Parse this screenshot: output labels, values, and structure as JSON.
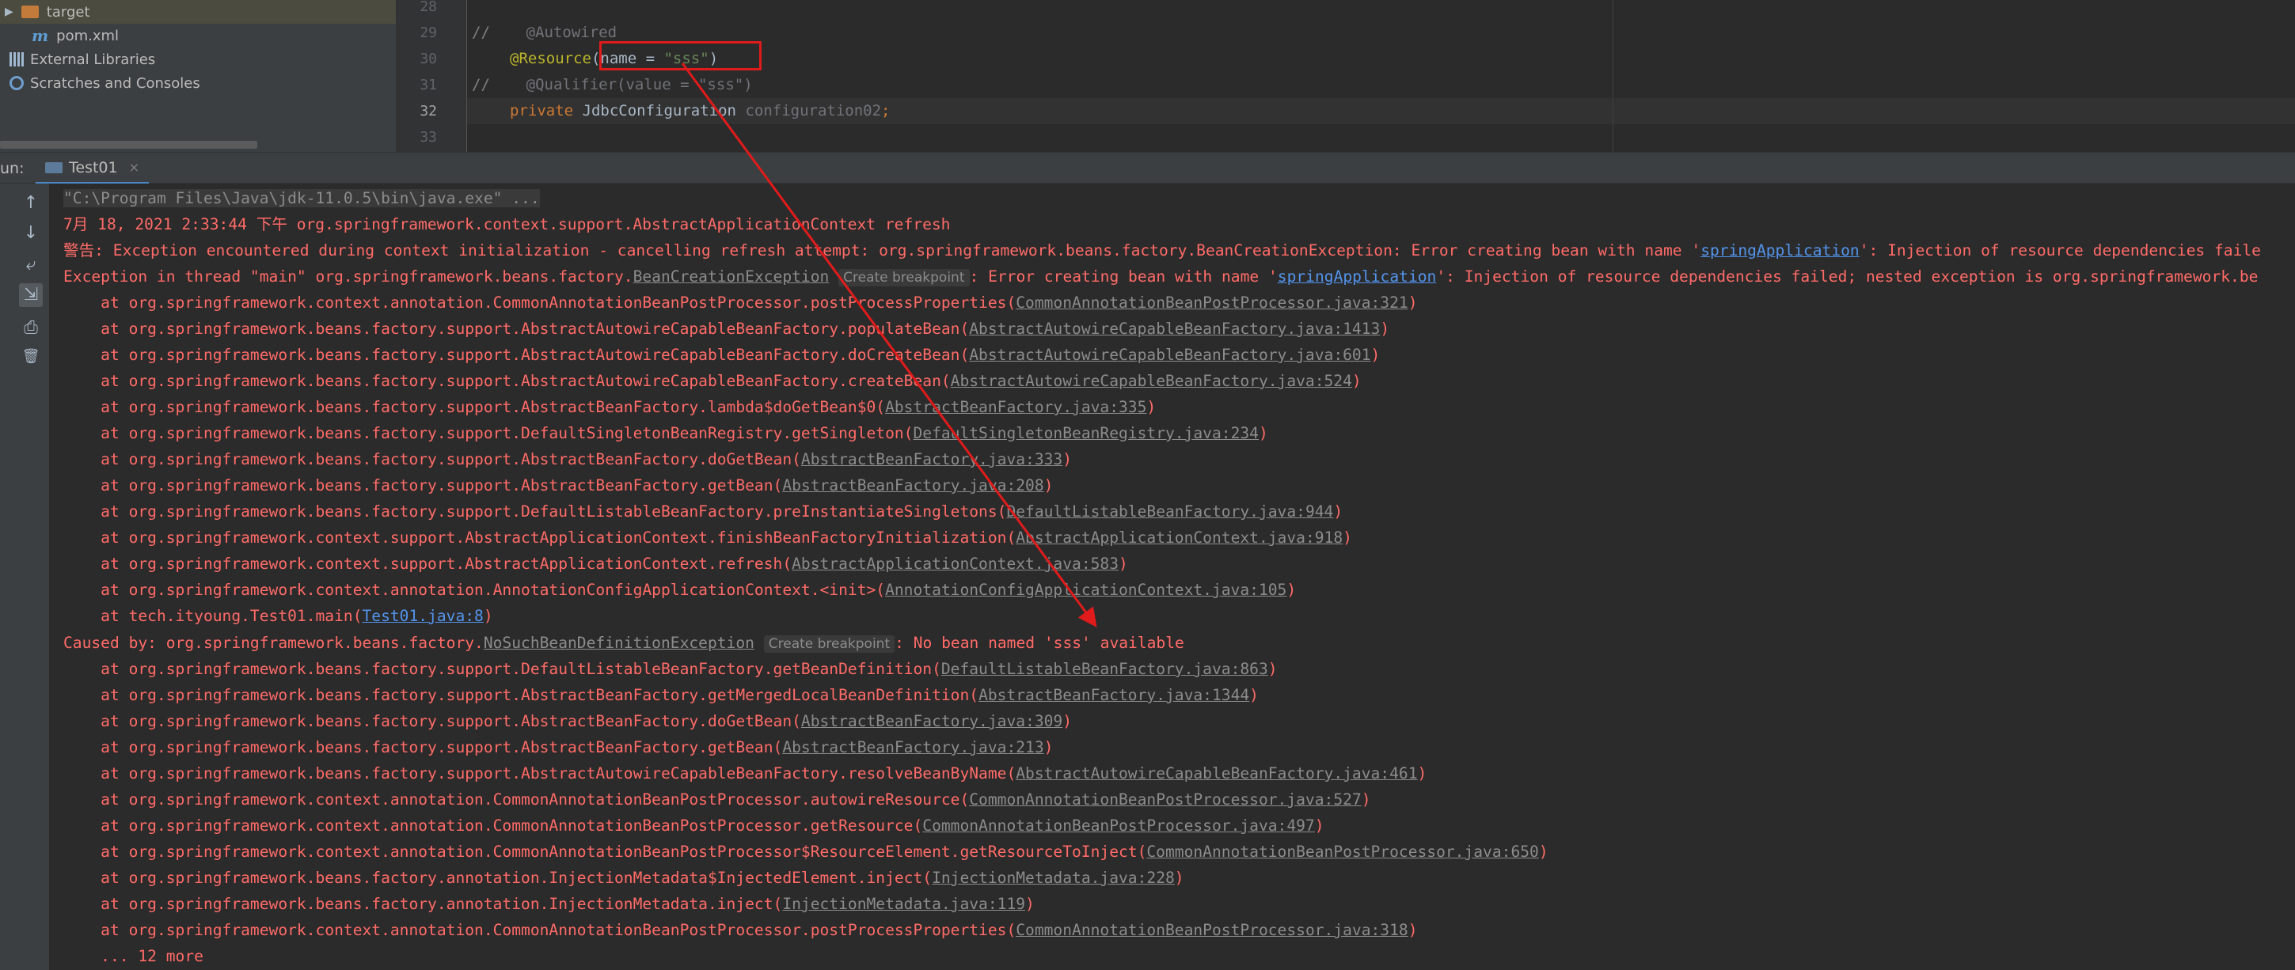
{
  "project_tree": [
    {
      "label": "target",
      "icon": "folder-icon",
      "kind": "folder"
    },
    {
      "label": "pom.xml",
      "icon": "maven-icon",
      "kind": "file"
    },
    {
      "label": "External Libraries",
      "icon": "library-icon",
      "kind": "node"
    },
    {
      "label": "Scratches and Consoles",
      "icon": "scratch-icon",
      "kind": "node"
    }
  ],
  "editor": {
    "line_numbers": [
      "28",
      "29",
      "30",
      "31",
      "32",
      "33"
    ],
    "current_line": "32",
    "lines": {
      "l29_comment": "//",
      "l29_text": "@Autowired",
      "l30_annotation": "@Resource",
      "l30_open": "(",
      "l30_name": "name = ",
      "l30_value": "\"sss\"",
      "l30_close": ")",
      "l31_comment": "//",
      "l31_text": "@Qualifier(value = \"sss\")",
      "l32_keyword": "private",
      "l32_type": "JdbcConfiguration",
      "l32_field": "configuration02",
      "l32_semicolon": ";"
    }
  },
  "run_panel": {
    "label": "un:",
    "tab_label": "Test01",
    "close_glyph": "×"
  },
  "toolbar": {
    "icons": [
      "up-arrow-icon",
      "down-arrow-icon",
      "soft-wrap-icon",
      "scroll-to-end-icon",
      "print-icon",
      "trash-icon"
    ],
    "glyphs": [
      "↑",
      "↓",
      "⤶",
      "⇲",
      "⎙",
      "🗑"
    ]
  },
  "console": {
    "cmd": "\"C:\\Program Files\\Java\\jdk-11.0.5\\bin\\java.exe\" ...",
    "line_date": "7月 18, 2021 2:33:44 下午 org.springframework.context.support.AbstractApplicationContext refresh",
    "warn_prefix": "警告: Exception encountered during context initialization - cancelling refresh attempt: org.springframework.beans.factory.BeanCreationException: Error creating bean with name '",
    "warn_link": "springApplication",
    "warn_suffix": "': Injection of resource dependencies faile",
    "exc_prefix": "Exception in thread \"main\" org.springframework.beans.factory.",
    "exc_link": "BeanCreationException",
    "breakpoint_label": "Create breakpoint",
    "exc_mid": ": Error creating bean with name '",
    "exc_link2": "springApplication",
    "exc_suffix": "': Injection of resource dependencies failed; nested exception is org.springframework.be",
    "trace1": [
      {
        "text": "\tat org.springframework.context.annotation.CommonAnnotationBeanPostProcessor.postProcessProperties(",
        "link": "CommonAnnotationBeanPostProcessor.java:321",
        "end": ")"
      },
      {
        "text": "\tat org.springframework.beans.factory.support.AbstractAutowireCapableBeanFactory.populateBean(",
        "link": "AbstractAutowireCapableBeanFactory.java:1413",
        "end": ")"
      },
      {
        "text": "\tat org.springframework.beans.factory.support.AbstractAutowireCapableBeanFactory.doCreateBean(",
        "link": "AbstractAutowireCapableBeanFactory.java:601",
        "end": ")"
      },
      {
        "text": "\tat org.springframework.beans.factory.support.AbstractAutowireCapableBeanFactory.createBean(",
        "link": "AbstractAutowireCapableBeanFactory.java:524",
        "end": ")"
      },
      {
        "text": "\tat org.springframework.beans.factory.support.AbstractBeanFactory.lambda$doGetBean$0(",
        "link": "AbstractBeanFactory.java:335",
        "end": ")"
      },
      {
        "text": "\tat org.springframework.beans.factory.support.DefaultSingletonBeanRegistry.getSingleton(",
        "link": "DefaultSingletonBeanRegistry.java:234",
        "end": ")"
      },
      {
        "text": "\tat org.springframework.beans.factory.support.AbstractBeanFactory.doGetBean(",
        "link": "AbstractBeanFactory.java:333",
        "end": ")"
      },
      {
        "text": "\tat org.springframework.beans.factory.support.AbstractBeanFactory.getBean(",
        "link": "AbstractBeanFactory.java:208",
        "end": ")"
      },
      {
        "text": "\tat org.springframework.beans.factory.support.DefaultListableBeanFactory.preInstantiateSingletons(",
        "link": "DefaultListableBeanFactory.java:944",
        "end": ")"
      },
      {
        "text": "\tat org.springframework.context.support.AbstractApplicationContext.finishBeanFactoryInitialization(",
        "link": "AbstractApplicationContext.java:918",
        "end": ")"
      },
      {
        "text": "\tat org.springframework.context.support.AbstractApplicationContext.refresh(",
        "link": "AbstractApplicationContext.java:583",
        "end": ")"
      },
      {
        "text": "\tat org.springframework.context.annotation.AnnotationConfigApplicationContext.<init>(",
        "link": "AnnotationConfigApplicationContext.java:105",
        "end": ")"
      },
      {
        "text": "\tat tech.ityoung.Test01.main(",
        "link": "Test01.java:8",
        "end": ")",
        "blue": true
      }
    ],
    "caused_prefix": "Caused by: org.springframework.beans.factory.",
    "caused_link": "NoSuchBeanDefinitionException",
    "caused_suffix": ": No bean named 'sss' available",
    "trace2": [
      {
        "text": "\tat org.springframework.beans.factory.support.DefaultListableBeanFactory.getBeanDefinition(",
        "link": "DefaultListableBeanFactory.java:863",
        "end": ")"
      },
      {
        "text": "\tat org.springframework.beans.factory.support.AbstractBeanFactory.getMergedLocalBeanDefinition(",
        "link": "AbstractBeanFactory.java:1344",
        "end": ")"
      },
      {
        "text": "\tat org.springframework.beans.factory.support.AbstractBeanFactory.doGetBean(",
        "link": "AbstractBeanFactory.java:309",
        "end": ")"
      },
      {
        "text": "\tat org.springframework.beans.factory.support.AbstractBeanFactory.getBean(",
        "link": "AbstractBeanFactory.java:213",
        "end": ")"
      },
      {
        "text": "\tat org.springframework.beans.factory.support.AbstractAutowireCapableBeanFactory.resolveBeanByName(",
        "link": "AbstractAutowireCapableBeanFactory.java:461",
        "end": ")"
      },
      {
        "text": "\tat org.springframework.context.annotation.CommonAnnotationBeanPostProcessor.autowireResource(",
        "link": "CommonAnnotationBeanPostProcessor.java:527",
        "end": ")"
      },
      {
        "text": "\tat org.springframework.context.annotation.CommonAnnotationBeanPostProcessor.getResource(",
        "link": "CommonAnnotationBeanPostProcessor.java:497",
        "end": ")"
      },
      {
        "text": "\tat org.springframework.context.annotation.CommonAnnotationBeanPostProcessor$ResourceElement.getResourceToInject(",
        "link": "CommonAnnotationBeanPostProcessor.java:650",
        "end": ")"
      },
      {
        "text": "\tat org.springframework.beans.factory.annotation.InjectionMetadata$InjectedElement.inject(",
        "link": "InjectionMetadata.java:228",
        "end": ")"
      },
      {
        "text": "\tat org.springframework.beans.factory.annotation.InjectionMetadata.inject(",
        "link": "InjectionMetadata.java:119",
        "end": ")"
      },
      {
        "text": "\tat org.springframework.context.annotation.CommonAnnotationBeanPostProcessor.postProcessProperties(",
        "link": "CommonAnnotationBeanPostProcessor.java:318",
        "end": ")"
      }
    ],
    "more": "\t... 12 more"
  },
  "colors": {
    "error_red": "#ff6b68",
    "link_blue": "#5394ec",
    "annotation_box": "#e01b1b"
  }
}
